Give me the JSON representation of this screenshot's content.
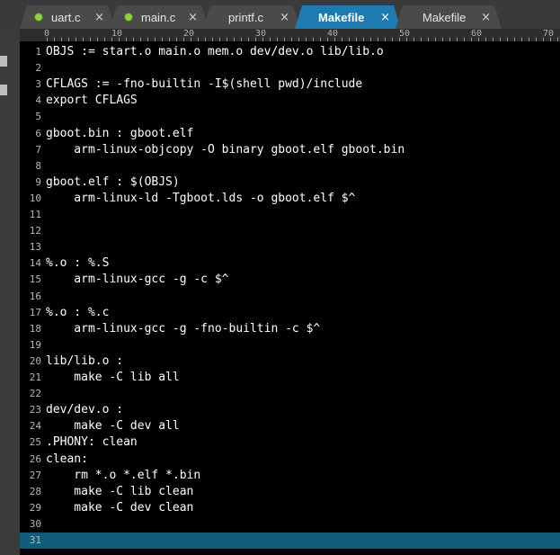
{
  "tabs": [
    {
      "label": "uart.c",
      "modified": true,
      "active": false
    },
    {
      "label": "main.c",
      "modified": true,
      "active": false
    },
    {
      "label": "printf.c",
      "modified": false,
      "active": false
    },
    {
      "label": "Makefile",
      "modified": false,
      "active": true
    },
    {
      "label": "Makefile",
      "modified": false,
      "active": false
    }
  ],
  "close_glyph": "×",
  "ruler": [
    "0",
    "10",
    "20",
    "30",
    "40",
    "50",
    "60",
    "70"
  ],
  "lines": [
    {
      "n": "1",
      "t": "OBJS := start.o main.o mem.o dev/dev.o lib/lib.o"
    },
    {
      "n": "2",
      "t": ""
    },
    {
      "n": "3",
      "t": "CFLAGS := -fno-builtin -I$(shell pwd)/include"
    },
    {
      "n": "4",
      "t": "export CFLAGS"
    },
    {
      "n": "5",
      "t": ""
    },
    {
      "n": "6",
      "t": "gboot.bin : gboot.elf"
    },
    {
      "n": "7",
      "t": "    arm-linux-objcopy -O binary gboot.elf gboot.bin"
    },
    {
      "n": "8",
      "t": ""
    },
    {
      "n": "9",
      "t": "gboot.elf : $(OBJS)"
    },
    {
      "n": "10",
      "t": "    arm-linux-ld -Tgboot.lds -o gboot.elf $^"
    },
    {
      "n": "11",
      "t": ""
    },
    {
      "n": "12",
      "t": ""
    },
    {
      "n": "13",
      "t": ""
    },
    {
      "n": "14",
      "t": "%.o : %.S"
    },
    {
      "n": "15",
      "t": "    arm-linux-gcc -g -c $^"
    },
    {
      "n": "16",
      "t": ""
    },
    {
      "n": "17",
      "t": "%.o : %.c"
    },
    {
      "n": "18",
      "t": "    arm-linux-gcc -g -fno-builtin -c $^"
    },
    {
      "n": "19",
      "t": ""
    },
    {
      "n": "20",
      "t": "lib/lib.o :"
    },
    {
      "n": "21",
      "t": "    make -C lib all"
    },
    {
      "n": "22",
      "t": ""
    },
    {
      "n": "23",
      "t": "dev/dev.o :"
    },
    {
      "n": "24",
      "t": "    make -C dev all"
    },
    {
      "n": "25",
      "t": ".PHONY: clean"
    },
    {
      "n": "26",
      "t": "clean:"
    },
    {
      "n": "27",
      "t": "    rm *.o *.elf *.bin"
    },
    {
      "n": "28",
      "t": "    make -C lib clean"
    },
    {
      "n": "29",
      "t": "    make -C dev clean"
    },
    {
      "n": "30",
      "t": ""
    },
    {
      "n": "31",
      "t": "",
      "current": true
    }
  ],
  "colors": {
    "active_tab": "#1f7ab0",
    "current_line": "#0f5d7a",
    "modified_dot": "#8fd13f",
    "editor_bg": "#000000"
  }
}
